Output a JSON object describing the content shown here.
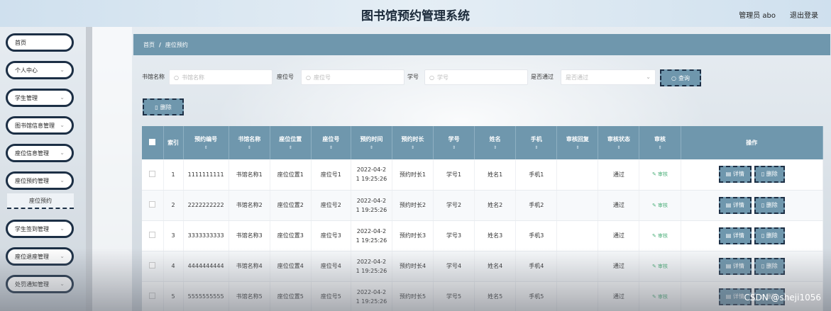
{
  "header": {
    "title": "图书馆预约管理系统",
    "user": "管理员 abo",
    "logout": "退出登录"
  },
  "sidebar": {
    "items": [
      {
        "label": "首页",
        "chevron": false
      },
      {
        "label": "个人中心",
        "chevron": true
      },
      {
        "label": "学生管理",
        "chevron": true
      },
      {
        "label": "图书馆信息管理",
        "chevron": true
      },
      {
        "label": "座位信息管理",
        "chevron": true
      },
      {
        "label": "座位预约管理",
        "chevron": true
      },
      {
        "label": "学生签到管理",
        "chevron": true
      },
      {
        "label": "座位退座管理",
        "chevron": true
      },
      {
        "label": "处罚通知管理",
        "chevron": true
      }
    ],
    "sub_item": "座位预约"
  },
  "breadcrumb": {
    "home": "首页",
    "separator": "/",
    "current": "座位预约"
  },
  "search": {
    "library_label": "书馆名称",
    "library_placeholder": "书馆名称",
    "seat_label": "座位号",
    "seat_placeholder": "座位号",
    "student_label": "学号",
    "student_placeholder": "学号",
    "passed_label": "是否通过",
    "passed_placeholder": "是否通过",
    "search_button": "查询",
    "delete_button": "删除"
  },
  "table": {
    "headers": [
      "索引",
      "预约编号",
      "书馆名称",
      "座位位置",
      "座位号",
      "预约时间",
      "预约时长",
      "学号",
      "姓名",
      "手机",
      "审核回复",
      "审核状态",
      "审核",
      "操作"
    ],
    "rows": [
      {
        "index": "1",
        "code": "1111111111",
        "lib": "书馆名称1",
        "pos": "座位位置1",
        "seat": "座位号1",
        "time1": "2022-04-2",
        "time2": "1 19:25:26",
        "dur": "预约时长1",
        "sid": "学号1",
        "name": "姓名1",
        "phone": "手机1",
        "reply": "",
        "status": "通过"
      },
      {
        "index": "2",
        "code": "2222222222",
        "lib": "书馆名称2",
        "pos": "座位位置2",
        "seat": "座位号2",
        "time1": "2022-04-2",
        "time2": "1 19:25:26",
        "dur": "预约时长2",
        "sid": "学号2",
        "name": "姓名2",
        "phone": "手机2",
        "reply": "",
        "status": "通过"
      },
      {
        "index": "3",
        "code": "3333333333",
        "lib": "书馆名称3",
        "pos": "座位位置3",
        "seat": "座位号3",
        "time1": "2022-04-2",
        "time2": "1 19:25:26",
        "dur": "预约时长3",
        "sid": "学号3",
        "name": "姓名3",
        "phone": "手机3",
        "reply": "",
        "status": "通过"
      },
      {
        "index": "4",
        "code": "4444444444",
        "lib": "书馆名称4",
        "pos": "座位位置4",
        "seat": "座位号4",
        "time1": "2022-04-2",
        "time2": "1 19:25:26",
        "dur": "预约时长4",
        "sid": "学号4",
        "name": "姓名4",
        "phone": "手机4",
        "reply": "",
        "status": "通过"
      },
      {
        "index": "5",
        "code": "5555555555",
        "lib": "书馆名称5",
        "pos": "座位位置5",
        "seat": "座位号5",
        "time1": "2022-04-2",
        "time2": "1 19:25:26",
        "dur": "预约时长5",
        "sid": "学号5",
        "name": "姓名5",
        "phone": "手机5",
        "reply": "",
        "status": "通过"
      }
    ],
    "audit_label": "审核",
    "detail_label": "详情",
    "delete_label": "删除"
  },
  "watermark": "CSDN @sheji1056",
  "colors": {
    "accent": "#6f97ad",
    "border_dark": "#1c2f45",
    "audit_green": "#4caf7a"
  }
}
